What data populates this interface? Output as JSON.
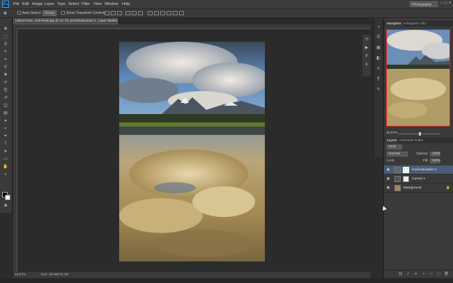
{
  "app": {
    "logo": "Ps",
    "menu": [
      "File",
      "Edit",
      "Image",
      "Layer",
      "Type",
      "Select",
      "Filter",
      "View",
      "Window",
      "Help"
    ],
    "workspace": "Photography",
    "window_controls": [
      "−",
      "□",
      "×"
    ]
  },
  "options_bar": {
    "auto_select_label": "Auto-Select:",
    "auto_select_value": "Group",
    "show_transform_label": "Show Transform Controls"
  },
  "document": {
    "tab_title": "Island Pass, Holt Peak.jpg @ 16.7% (Hue/Saturation 1, Layer Mask/8) *",
    "zoom": "16.67%",
    "doc_info": "Doc: 46.8M/73.7M"
  },
  "tools": {
    "items": [
      "move",
      "marquee",
      "lasso",
      "quick-select",
      "crop",
      "eyedropper",
      "healing",
      "brush",
      "clone",
      "history",
      "eraser",
      "gradient",
      "blur",
      "dodge",
      "pen",
      "type",
      "path-select",
      "shape",
      "hand",
      "zoom"
    ]
  },
  "navigator": {
    "tabs": [
      "Navigator",
      "Histogram",
      "Info"
    ],
    "zoom": "16.67%"
  },
  "layers": {
    "tabs": [
      "Layers",
      "Channels",
      "Paths"
    ],
    "filter_kind": "Kind",
    "blend_mode": "Normal",
    "opacity_label": "Opacity:",
    "opacity_value": "100%",
    "lock_label": "Lock:",
    "fill_label": "Fill:",
    "fill_value": "100%",
    "items": [
      {
        "name": "Hue/Saturation 1",
        "selected": true
      },
      {
        "name": "Curves 1",
        "selected": false
      },
      {
        "name": "Background",
        "selected": false
      }
    ]
  },
  "colors": {
    "accent": "#31a8ff",
    "selection": "#4a5d77",
    "nav_frame": "#dd2222"
  }
}
